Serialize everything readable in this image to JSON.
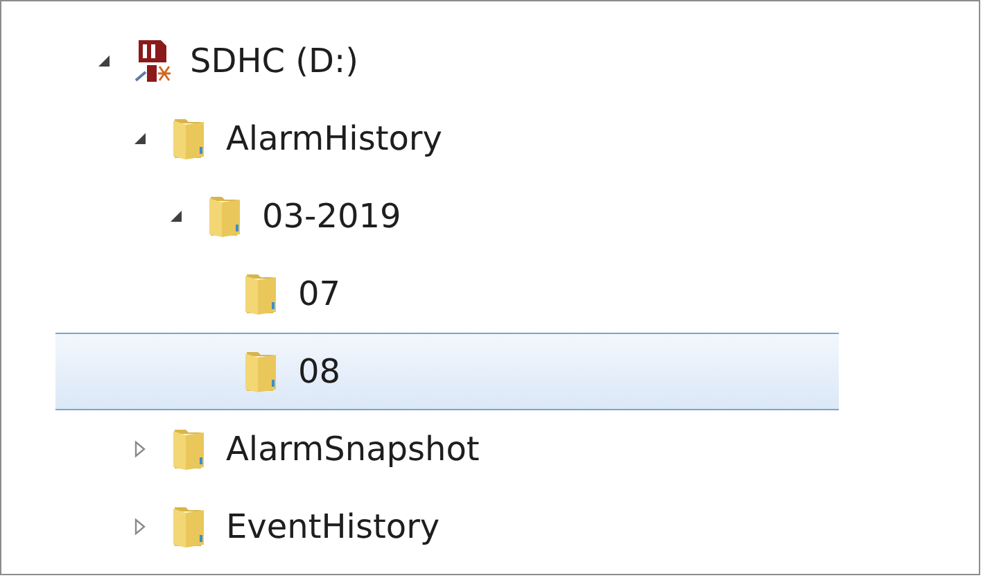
{
  "tree": [
    {
      "kind": "drive",
      "label": "SDHC (D:)",
      "expanded": true,
      "selected": false,
      "children": [
        {
          "kind": "folder",
          "label": "AlarmHistory",
          "expanded": true,
          "selected": false,
          "children": [
            {
              "kind": "folder",
              "label": "03-2019",
              "expanded": true,
              "selected": false,
              "children": [
                {
                  "kind": "folder",
                  "label": "07",
                  "selected": false
                },
                {
                  "kind": "folder",
                  "label": "08",
                  "selected": true
                }
              ]
            }
          ]
        },
        {
          "kind": "folder",
          "label": "AlarmSnapshot",
          "expanded": false,
          "selected": false
        },
        {
          "kind": "folder",
          "label": "EventHistory",
          "expanded": false,
          "selected": false
        }
      ]
    }
  ]
}
